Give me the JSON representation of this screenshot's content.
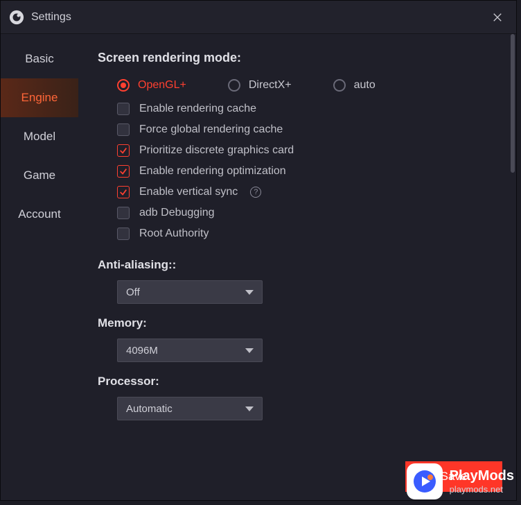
{
  "window": {
    "title": "Settings"
  },
  "sidebar": {
    "items": [
      {
        "label": "Basic",
        "active": false
      },
      {
        "label": "Engine",
        "active": true
      },
      {
        "label": "Model",
        "active": false
      },
      {
        "label": "Game",
        "active": false
      },
      {
        "label": "Account",
        "active": false
      }
    ]
  },
  "engine": {
    "heading_rendering": "Screen rendering mode:",
    "radios": [
      {
        "label": "OpenGL+",
        "selected": true
      },
      {
        "label": "DirectX+",
        "selected": false
      },
      {
        "label": "auto",
        "selected": false
      }
    ],
    "checkboxes": [
      {
        "label": "Enable rendering cache",
        "checked": false,
        "help": false
      },
      {
        "label": "Force global rendering cache",
        "checked": false,
        "help": false
      },
      {
        "label": "Prioritize discrete graphics card",
        "checked": true,
        "help": false
      },
      {
        "label": "Enable rendering optimization",
        "checked": true,
        "help": false
      },
      {
        "label": "Enable vertical sync",
        "checked": true,
        "help": true
      },
      {
        "label": "adb Debugging",
        "checked": false,
        "help": false
      },
      {
        "label": "Root Authority",
        "checked": false,
        "help": false
      }
    ],
    "antialiasing": {
      "label": "Anti-aliasing::",
      "value": "Off"
    },
    "memory": {
      "label": "Memory:",
      "value": "4096M"
    },
    "processor": {
      "label": "Processor:",
      "value": "Automatic"
    }
  },
  "footer": {
    "save": "Save"
  },
  "watermark": {
    "title": "PlayMods",
    "subtitle": "playmods.net"
  }
}
